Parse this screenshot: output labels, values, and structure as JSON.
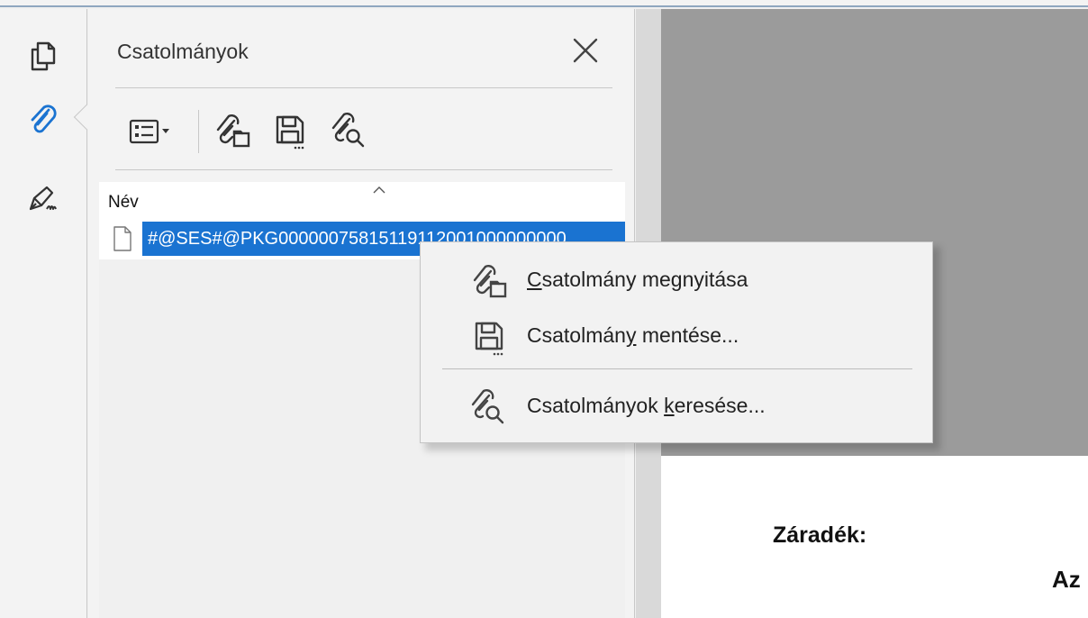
{
  "panel": {
    "title": "Csatolmányok",
    "column_header": "Név",
    "row": {
      "file_name": "#@SES#@PKG00000075815119112001000000000"
    }
  },
  "context_menu": {
    "open": {
      "first": "C",
      "rest": "satolmány megnyitása"
    },
    "save": {
      "before": "Csatolmán",
      "ul": "y",
      "after": " mentése..."
    },
    "search": {
      "before": "Csatolmányok ",
      "ul": "k",
      "after": "eresése..."
    }
  },
  "document": {
    "line1": "Záradék:",
    "line2": "Az"
  },
  "colors": {
    "accent": "#1a73d1",
    "rail_icon_active": "#1a73d1"
  },
  "icons": {
    "rail": [
      "pages-icon",
      "attachment-icon",
      "signature-icon"
    ],
    "toolbar": [
      "options-menu-icon",
      "open-attachment-icon",
      "save-attachment-icon",
      "search-attachment-icon"
    ]
  }
}
